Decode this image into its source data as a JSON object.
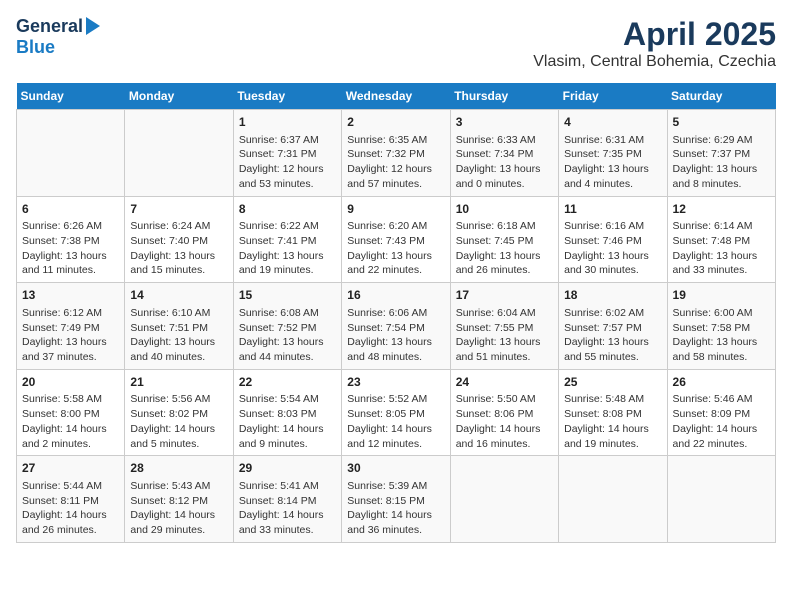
{
  "header": {
    "logo_line1": "General",
    "logo_line2": "Blue",
    "title": "April 2025",
    "subtitle": "Vlasim, Central Bohemia, Czechia"
  },
  "days_of_week": [
    "Sunday",
    "Monday",
    "Tuesday",
    "Wednesday",
    "Thursday",
    "Friday",
    "Saturday"
  ],
  "weeks": [
    [
      {
        "day": "",
        "content": ""
      },
      {
        "day": "",
        "content": ""
      },
      {
        "day": "1",
        "content": "Sunrise: 6:37 AM\nSunset: 7:31 PM\nDaylight: 12 hours and 53 minutes."
      },
      {
        "day": "2",
        "content": "Sunrise: 6:35 AM\nSunset: 7:32 PM\nDaylight: 12 hours and 57 minutes."
      },
      {
        "day": "3",
        "content": "Sunrise: 6:33 AM\nSunset: 7:34 PM\nDaylight: 13 hours and 0 minutes."
      },
      {
        "day": "4",
        "content": "Sunrise: 6:31 AM\nSunset: 7:35 PM\nDaylight: 13 hours and 4 minutes."
      },
      {
        "day": "5",
        "content": "Sunrise: 6:29 AM\nSunset: 7:37 PM\nDaylight: 13 hours and 8 minutes."
      }
    ],
    [
      {
        "day": "6",
        "content": "Sunrise: 6:26 AM\nSunset: 7:38 PM\nDaylight: 13 hours and 11 minutes."
      },
      {
        "day": "7",
        "content": "Sunrise: 6:24 AM\nSunset: 7:40 PM\nDaylight: 13 hours and 15 minutes."
      },
      {
        "day": "8",
        "content": "Sunrise: 6:22 AM\nSunset: 7:41 PM\nDaylight: 13 hours and 19 minutes."
      },
      {
        "day": "9",
        "content": "Sunrise: 6:20 AM\nSunset: 7:43 PM\nDaylight: 13 hours and 22 minutes."
      },
      {
        "day": "10",
        "content": "Sunrise: 6:18 AM\nSunset: 7:45 PM\nDaylight: 13 hours and 26 minutes."
      },
      {
        "day": "11",
        "content": "Sunrise: 6:16 AM\nSunset: 7:46 PM\nDaylight: 13 hours and 30 minutes."
      },
      {
        "day": "12",
        "content": "Sunrise: 6:14 AM\nSunset: 7:48 PM\nDaylight: 13 hours and 33 minutes."
      }
    ],
    [
      {
        "day": "13",
        "content": "Sunrise: 6:12 AM\nSunset: 7:49 PM\nDaylight: 13 hours and 37 minutes."
      },
      {
        "day": "14",
        "content": "Sunrise: 6:10 AM\nSunset: 7:51 PM\nDaylight: 13 hours and 40 minutes."
      },
      {
        "day": "15",
        "content": "Sunrise: 6:08 AM\nSunset: 7:52 PM\nDaylight: 13 hours and 44 minutes."
      },
      {
        "day": "16",
        "content": "Sunrise: 6:06 AM\nSunset: 7:54 PM\nDaylight: 13 hours and 48 minutes."
      },
      {
        "day": "17",
        "content": "Sunrise: 6:04 AM\nSunset: 7:55 PM\nDaylight: 13 hours and 51 minutes."
      },
      {
        "day": "18",
        "content": "Sunrise: 6:02 AM\nSunset: 7:57 PM\nDaylight: 13 hours and 55 minutes."
      },
      {
        "day": "19",
        "content": "Sunrise: 6:00 AM\nSunset: 7:58 PM\nDaylight: 13 hours and 58 minutes."
      }
    ],
    [
      {
        "day": "20",
        "content": "Sunrise: 5:58 AM\nSunset: 8:00 PM\nDaylight: 14 hours and 2 minutes."
      },
      {
        "day": "21",
        "content": "Sunrise: 5:56 AM\nSunset: 8:02 PM\nDaylight: 14 hours and 5 minutes."
      },
      {
        "day": "22",
        "content": "Sunrise: 5:54 AM\nSunset: 8:03 PM\nDaylight: 14 hours and 9 minutes."
      },
      {
        "day": "23",
        "content": "Sunrise: 5:52 AM\nSunset: 8:05 PM\nDaylight: 14 hours and 12 minutes."
      },
      {
        "day": "24",
        "content": "Sunrise: 5:50 AM\nSunset: 8:06 PM\nDaylight: 14 hours and 16 minutes."
      },
      {
        "day": "25",
        "content": "Sunrise: 5:48 AM\nSunset: 8:08 PM\nDaylight: 14 hours and 19 minutes."
      },
      {
        "day": "26",
        "content": "Sunrise: 5:46 AM\nSunset: 8:09 PM\nDaylight: 14 hours and 22 minutes."
      }
    ],
    [
      {
        "day": "27",
        "content": "Sunrise: 5:44 AM\nSunset: 8:11 PM\nDaylight: 14 hours and 26 minutes."
      },
      {
        "day": "28",
        "content": "Sunrise: 5:43 AM\nSunset: 8:12 PM\nDaylight: 14 hours and 29 minutes."
      },
      {
        "day": "29",
        "content": "Sunrise: 5:41 AM\nSunset: 8:14 PM\nDaylight: 14 hours and 33 minutes."
      },
      {
        "day": "30",
        "content": "Sunrise: 5:39 AM\nSunset: 8:15 PM\nDaylight: 14 hours and 36 minutes."
      },
      {
        "day": "",
        "content": ""
      },
      {
        "day": "",
        "content": ""
      },
      {
        "day": "",
        "content": ""
      }
    ]
  ]
}
